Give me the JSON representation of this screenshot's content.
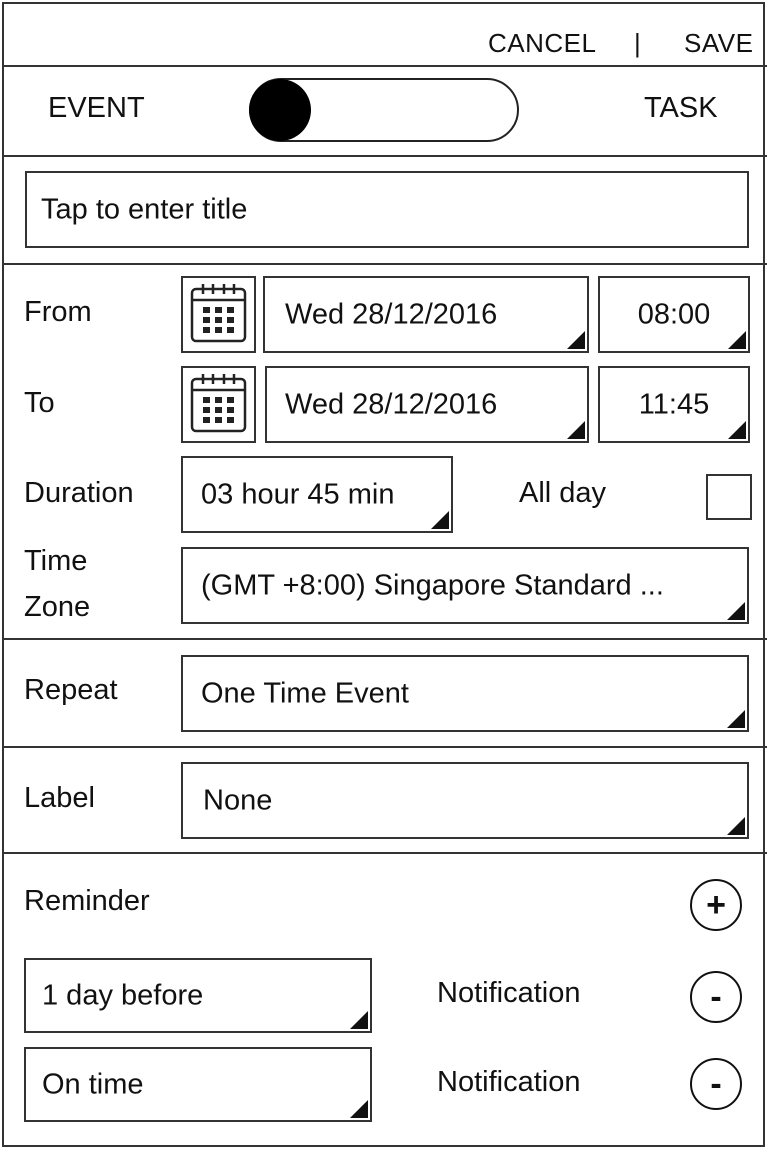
{
  "header": {
    "cancel_label": "CANCEL",
    "separator": "|",
    "save_label": "SAVE"
  },
  "type_toggle": {
    "left_label": "EVENT",
    "right_label": "TASK",
    "selected": "EVENT"
  },
  "title_field": {
    "placeholder": "Tap to enter title"
  },
  "from": {
    "label": "From",
    "date": "Wed 28/12/2016",
    "time": "08:00"
  },
  "to": {
    "label": "To",
    "date": "Wed 28/12/2016",
    "time": "11:45"
  },
  "duration": {
    "label": "Duration",
    "value": "03 hour 45 min"
  },
  "all_day": {
    "label": "All day",
    "checked": false
  },
  "timezone": {
    "label_line1": "Time",
    "label_line2": "Zone",
    "value": "(GMT +8:00) Singapore Standard ..."
  },
  "repeat": {
    "label": "Repeat",
    "value": "One Time Event"
  },
  "label_field": {
    "label": "Label",
    "value": "None"
  },
  "reminder": {
    "label": "Reminder",
    "add_symbol": "+",
    "items": [
      {
        "when": "1 day before",
        "type": "Notification",
        "remove_symbol": "-"
      },
      {
        "when": "On time",
        "type": "Notification",
        "remove_symbol": "-"
      }
    ]
  },
  "icons": {
    "calendar": "calendar-icon",
    "dropdown": "dropdown-corner-icon",
    "add": "plus-circle-icon",
    "remove": "minus-circle-icon"
  }
}
